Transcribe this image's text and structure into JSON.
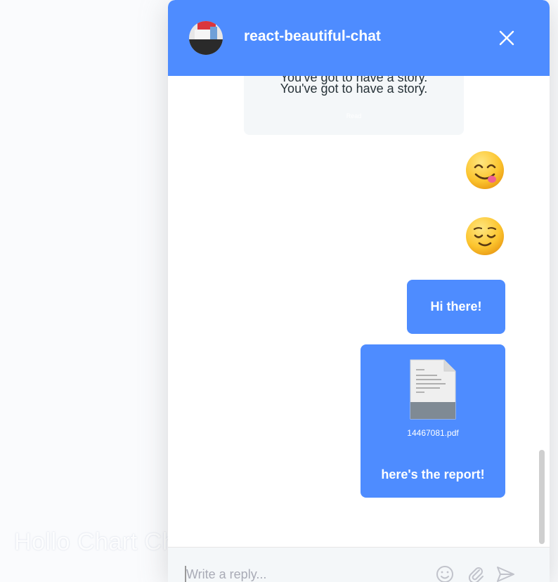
{
  "background": {
    "caption": "Hollo Chart Chat"
  },
  "header": {
    "title": "react-beautiful-chat",
    "close_icon": "close-icon",
    "color": "#4e8cff"
  },
  "messages": {
    "received": {
      "line1": "You've got to have a story.",
      "line2": "You've got to have a story.",
      "meta": "Read"
    },
    "emoji_1": "yum-face-emoji",
    "emoji_2": "relieved-face-emoji",
    "sent_text": "Hi there!",
    "file": {
      "icon": "pdf-file-icon",
      "name": "14467081.pdf",
      "caption": "here's the report!"
    }
  },
  "composer": {
    "placeholder": "Write a reply...",
    "icons": [
      "emoji-icon",
      "paperclip-icon",
      "send-icon"
    ]
  }
}
